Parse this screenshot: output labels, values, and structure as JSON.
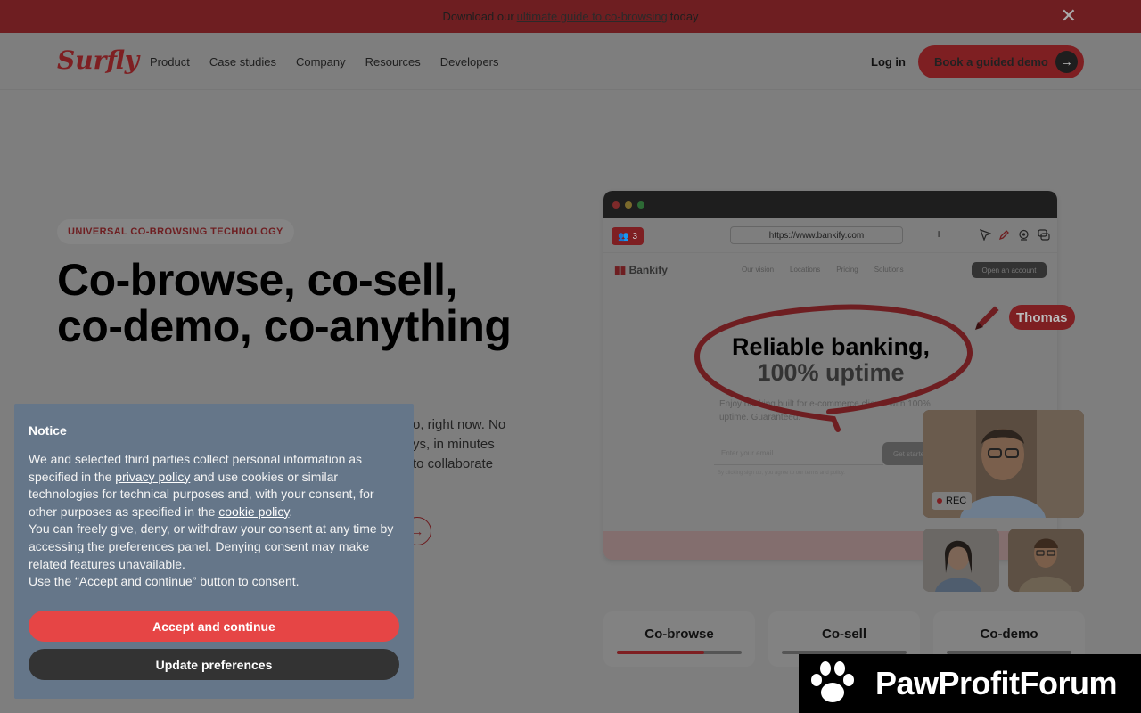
{
  "banner": {
    "prefix": "Download our",
    "link": "ultimate guide to co-browsing",
    "suffix": "today",
    "close": "✕"
  },
  "nav": {
    "logo": "Surfly",
    "items": [
      "Product",
      "Case studies",
      "Company",
      "Resources",
      "Developers"
    ],
    "login": "Log in",
    "cta": "Book a guided demo"
  },
  "hero": {
    "eyebrow": "UNIVERSAL CO-BROWSING TECHNOLOGY",
    "title": "Co-browse, co-sell, co-demo, co-anything",
    "subtitle_lines": [
      "o, right now. No",
      "ys, in minutes",
      "to collaborate"
    ]
  },
  "mockup": {
    "participants": "3",
    "url": "https://www.bankify.com",
    "site_logo": "Bankify",
    "site_links": [
      "Our vision",
      "Locations",
      "Pricing",
      "Solutions"
    ],
    "site_cta": "Open an account",
    "headline_1": "Reliable banking,",
    "headline_2": "100% uptime",
    "body": "Enjoy banking built for e-commerce clients with 100% uptime. Guaranteed.",
    "email_placeholder": "Enter your email",
    "cta": "Get started",
    "legal": "By clicking sign up, you agree to our terms and policy.",
    "cursor_name": "Thomas",
    "rec_label": "REC"
  },
  "tabs": [
    {
      "label": "Co-browse",
      "progress": 0.7
    },
    {
      "label": "Co-sell",
      "progress": 0
    },
    {
      "label": "Co-demo",
      "progress": 0
    }
  ],
  "cookie": {
    "title": "Notice",
    "p1_a": "We and selected third parties collect personal information as specified in the ",
    "privacy_link": "privacy policy",
    "p1_b": " and use cookies or similar technologies for technical purposes and, with your consent, for other purposes as specified in the ",
    "cookie_link": "cookie policy",
    "p1_c": ".",
    "p2": "You can freely give, deny, or withdraw your consent at any time by accessing the preferences panel. Denying consent may make related features unavailable.",
    "p3": "Use the “Accept and continue” button to consent.",
    "accept": "Accept and continue",
    "preferences": "Update preferences"
  },
  "watermark": {
    "text": "PawProfitForum"
  },
  "colors": {
    "brand": "#c0313a",
    "accept": "#e64545"
  }
}
